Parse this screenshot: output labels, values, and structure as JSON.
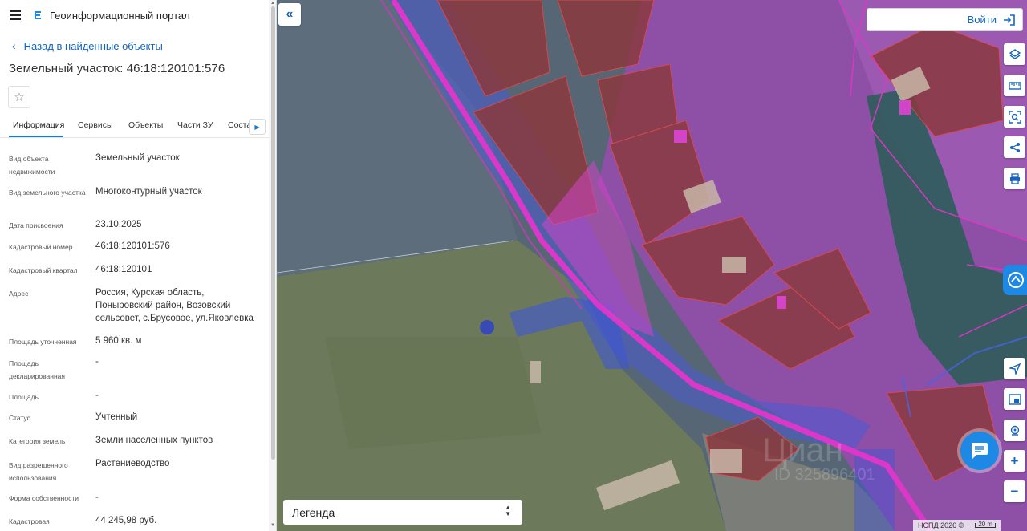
{
  "header": {
    "app_title": "Геоинформационный портал",
    "menu_icon": "hamburger-menu-icon",
    "logo_icon": "portal-logo-icon"
  },
  "nav": {
    "back_label": "Назад в найденные объекты"
  },
  "object": {
    "title": "Земельный участок: 46:18:120101:576"
  },
  "tabs": [
    {
      "label": "Информация",
      "active": true
    },
    {
      "label": "Сервисы",
      "active": false
    },
    {
      "label": "Объекты",
      "active": false
    },
    {
      "label": "Части ЗУ",
      "active": false
    },
    {
      "label": "Соста",
      "active": false
    }
  ],
  "properties": [
    {
      "label": "Вид объекта недвижимости",
      "value": "Земельный участок"
    },
    {
      "label": "Вид земельного участка",
      "value": "Многоконтурный участок"
    },
    {
      "label": "Дата присвоения",
      "value": "23.10.2025"
    },
    {
      "label": "Кадастровый номер",
      "value": "46:18:120101:576"
    },
    {
      "label": "Кадастровый квартал",
      "value": "46:18:120101"
    },
    {
      "label": "Адрес",
      "value": "Россия, Курская область, Поныровский район, Возовский сельсовет, с.Брусовое, ул.Яковлевка"
    },
    {
      "label": "Площадь уточненная",
      "value": "5 960 кв. м"
    },
    {
      "label": "Площадь декларированная",
      "value": "-"
    },
    {
      "label": "Площадь",
      "value": "-"
    },
    {
      "label": "Статус",
      "value": "Учтенный"
    },
    {
      "label": "Категория земель",
      "value": "Земли населенных пунктов"
    },
    {
      "label": "Вид разрешенного использования",
      "value": "Растениеводство"
    },
    {
      "label": "Форма собственности",
      "value": "-"
    },
    {
      "label": "Кадастровая",
      "value": "44 245,98 руб."
    }
  ],
  "map": {
    "login_label": "Войти",
    "legend_label": "Легенда",
    "attribution": "НСПД 2026 ©",
    "scale_label": "20 m",
    "zoom_in": "+",
    "zoom_out": "−",
    "tools": [
      "layers-icon",
      "ruler-icon",
      "select-area-icon",
      "share-icon",
      "print-icon",
      "locate-icon",
      "minimap-icon",
      "pin-icon"
    ],
    "colors": {
      "parcel_fill": "#8a3a3f",
      "parcel_stroke": "#e34848",
      "zone_purple": "#9b3fc0",
      "road_pink": "#e236c9",
      "water_blue": "#3f55d6",
      "accent": "#1e88e5"
    }
  }
}
